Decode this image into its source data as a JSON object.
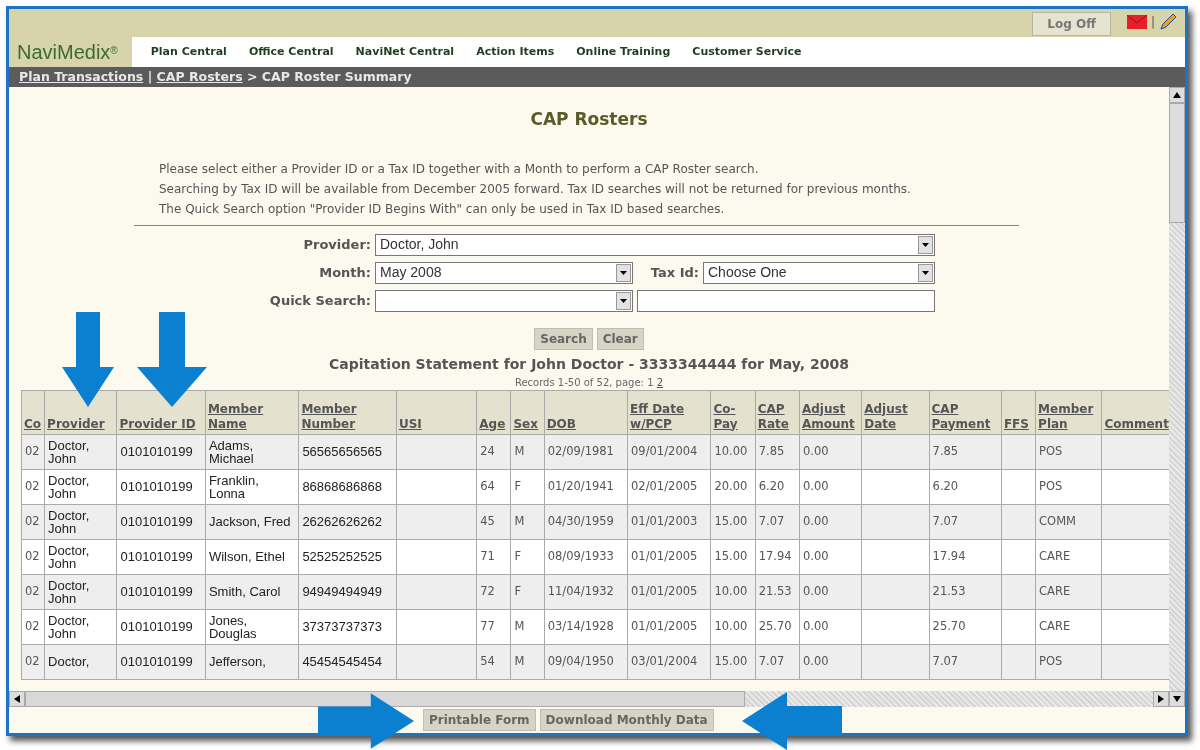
{
  "header": {
    "logo": "NaviMedix$^{®}$",
    "log_off": "Log Off",
    "separator": "|"
  },
  "nav": [
    "Plan Central",
    "Office Central",
    "NaviNet Central",
    "Action Items",
    "Online Training",
    "Customer Service"
  ],
  "breadcrumb": {
    "links": [
      "Plan Transactions",
      "CAP Rosters"
    ],
    "separator": "|",
    "arrow": ">",
    "current": "CAP Roster Summary"
  },
  "title": "CAP Rosters",
  "intro_lines": [
    "Please select either a Provider ID or a Tax ID together with a Month to perform a CAP Roster search.",
    "Searching by Tax ID will be available from December 2005 forward. Tax ID searches will not be returned for previous months.",
    "The Quick Search option \"Provider ID Begins With\" can only be used in Tax ID based searches."
  ],
  "form": {
    "provider": {
      "label": "Provider:",
      "value": "Doctor, John"
    },
    "month": {
      "label": "Month:",
      "value": "May 2008"
    },
    "tax_id": {
      "label": "Tax Id:",
      "value": "Choose One"
    },
    "quick_search": {
      "label": "Quick Search:"
    }
  },
  "buttons": [
    "Search",
    "Clear"
  ],
  "caption": "Capitation Statement for John Doctor - 3333344444 for May, 2008",
  "records": {
    "text": "Records 1-50 of 52, page:",
    "pages": [
      {
        "label": "1",
        "selected": true
      },
      {
        "label": "2",
        "selected": false
      }
    ]
  },
  "table": {
    "columns": [
      "Co",
      "Provider",
      "Provider ID",
      "Member Name",
      "Member Number",
      "USI",
      "Age",
      "Sex",
      "DOB",
      "Eff Date w/PCP",
      "Co-Pay",
      "CAP Rate",
      "Adjust Amount",
      "Adjust Date",
      "CAP Payment",
      "FFS",
      "Member Plan",
      "Comment"
    ],
    "rows": [
      [
        "02",
        "Doctor, John",
        "0101010199",
        "Adams, Michael",
        "56565656565",
        "",
        "24",
        "M",
        "02/09/1981",
        "09/01/2004",
        "10.00",
        "7.85",
        "0.00",
        "",
        "7.85",
        "",
        "POS",
        ""
      ],
      [
        "02",
        "Doctor, John",
        "0101010199",
        "Franklin, Lonna",
        "86868686868",
        "",
        "64",
        "F",
        "01/20/1941",
        "02/01/2005",
        "20.00",
        "6.20",
        "0.00",
        "",
        "6.20",
        "",
        "POS",
        ""
      ],
      [
        "02",
        "Doctor, John",
        "0101010199",
        "Jackson, Fred",
        "26262626262",
        "",
        "45",
        "M",
        "04/30/1959",
        "01/01/2003",
        "15.00",
        "7.07",
        "0.00",
        "",
        "7.07",
        "",
        "COMM",
        ""
      ],
      [
        "02",
        "Doctor, John",
        "0101010199",
        "Wilson, Ethel",
        "52525252525",
        "",
        "71",
        "F",
        "08/09/1933",
        "01/01/2005",
        "15.00",
        "17.94",
        "0.00",
        "",
        "17.94",
        "",
        "CARE",
        ""
      ],
      [
        "02",
        "Doctor, John",
        "0101010199",
        "Smith, Carol",
        "94949494949",
        "",
        "72",
        "F",
        "11/04/1932",
        "01/01/2005",
        "10.00",
        "21.53",
        "0.00",
        "",
        "21.53",
        "",
        "CARE",
        ""
      ],
      [
        "02",
        "Doctor, John",
        "0101010199",
        "Jones, Douglas",
        "37373737373",
        "",
        "77",
        "M",
        "03/14/1928",
        "01/01/2005",
        "10.00",
        "25.70",
        "0.00",
        "",
        "25.70",
        "",
        "CARE",
        ""
      ],
      [
        "02",
        "Doctor,",
        "0101010199",
        "Jefferson,",
        "45454545454",
        "",
        "54",
        "M",
        "09/04/1950",
        "03/01/2004",
        "15.00",
        "7.07",
        "0.00",
        "",
        "7.07",
        "",
        "POS",
        ""
      ]
    ]
  },
  "footer_buttons": [
    "Printable Form",
    "Download Monthly Data"
  ]
}
